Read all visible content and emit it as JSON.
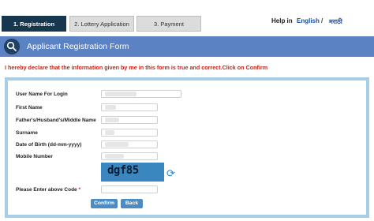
{
  "steps": [
    {
      "label": "1. Registration"
    },
    {
      "label": "2. Lottery Application"
    },
    {
      "label": "3. Payment"
    }
  ],
  "header": {
    "help_label": "Help in",
    "lang_en": "English",
    "lang_sep": "/",
    "lang_mr": "मराठी"
  },
  "form_bar": {
    "title": "Applicant Registration Form",
    "icon": "search-icon"
  },
  "declaration": "I hereby declare that the information given by me in this form is true and correct.Click on Confirm",
  "fields": {
    "username_label": "User Name For Login",
    "firstname_label": "First Name",
    "middlename_label": "Father's/Husband's/Middle Name",
    "surname_label": "Surname",
    "dob_label": "Date of Birth (dd-mm-yyyy)",
    "mobile_label": "Mobile Number",
    "captcha_label": "Please Enter above Code",
    "captcha_required": "*"
  },
  "captcha": {
    "code": "dgf85"
  },
  "buttons": {
    "confirm": "Confirm",
    "back": "Back"
  },
  "colors": {
    "active_step": "#17374f",
    "form_bar": "#5b82c2",
    "declaration_text": "#c42418",
    "panel_border": "#a6cee4",
    "button": "#4c8cc4"
  }
}
